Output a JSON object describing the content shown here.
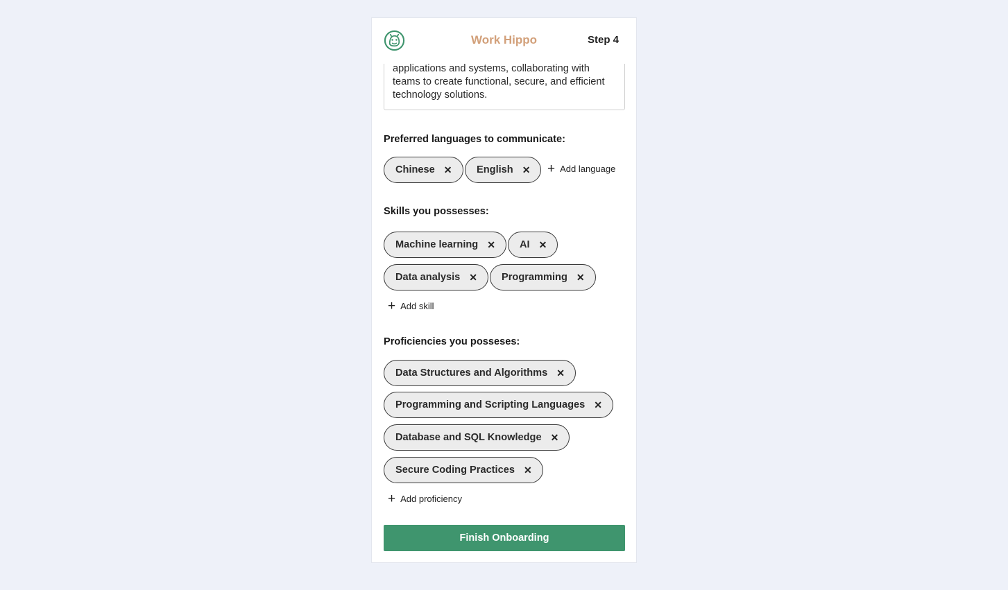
{
  "header": {
    "logo_icon": "hippo-logo-icon",
    "brand": "Work Hippo",
    "step": "Step 4",
    "brand_color": "#d2a07a"
  },
  "about": {
    "text": "applications and systems, collaborating with teams to create functional, secure, and efficient technology solutions."
  },
  "languages": {
    "label": "Preferred languages to communicate:",
    "items": [
      "Chinese",
      "English"
    ],
    "add_label": "Add language"
  },
  "skills": {
    "label": "Skills you possesses:",
    "items": [
      "Machine learning",
      "AI",
      "Data analysis",
      "Programming"
    ],
    "add_label": "Add skill"
  },
  "proficiencies": {
    "label": "Proficiencies you posseses:",
    "items": [
      "Data Structures and Algorithms",
      "Programming and Scripting Languages",
      "Database and SQL Knowledge",
      "Secure Coding Practices"
    ],
    "add_label": "Add proficiency"
  },
  "chip_remove_icon": "close-icon",
  "add_icon": "plus-icon",
  "finish": {
    "label": "Finish Onboarding",
    "color": "#3f956e"
  }
}
